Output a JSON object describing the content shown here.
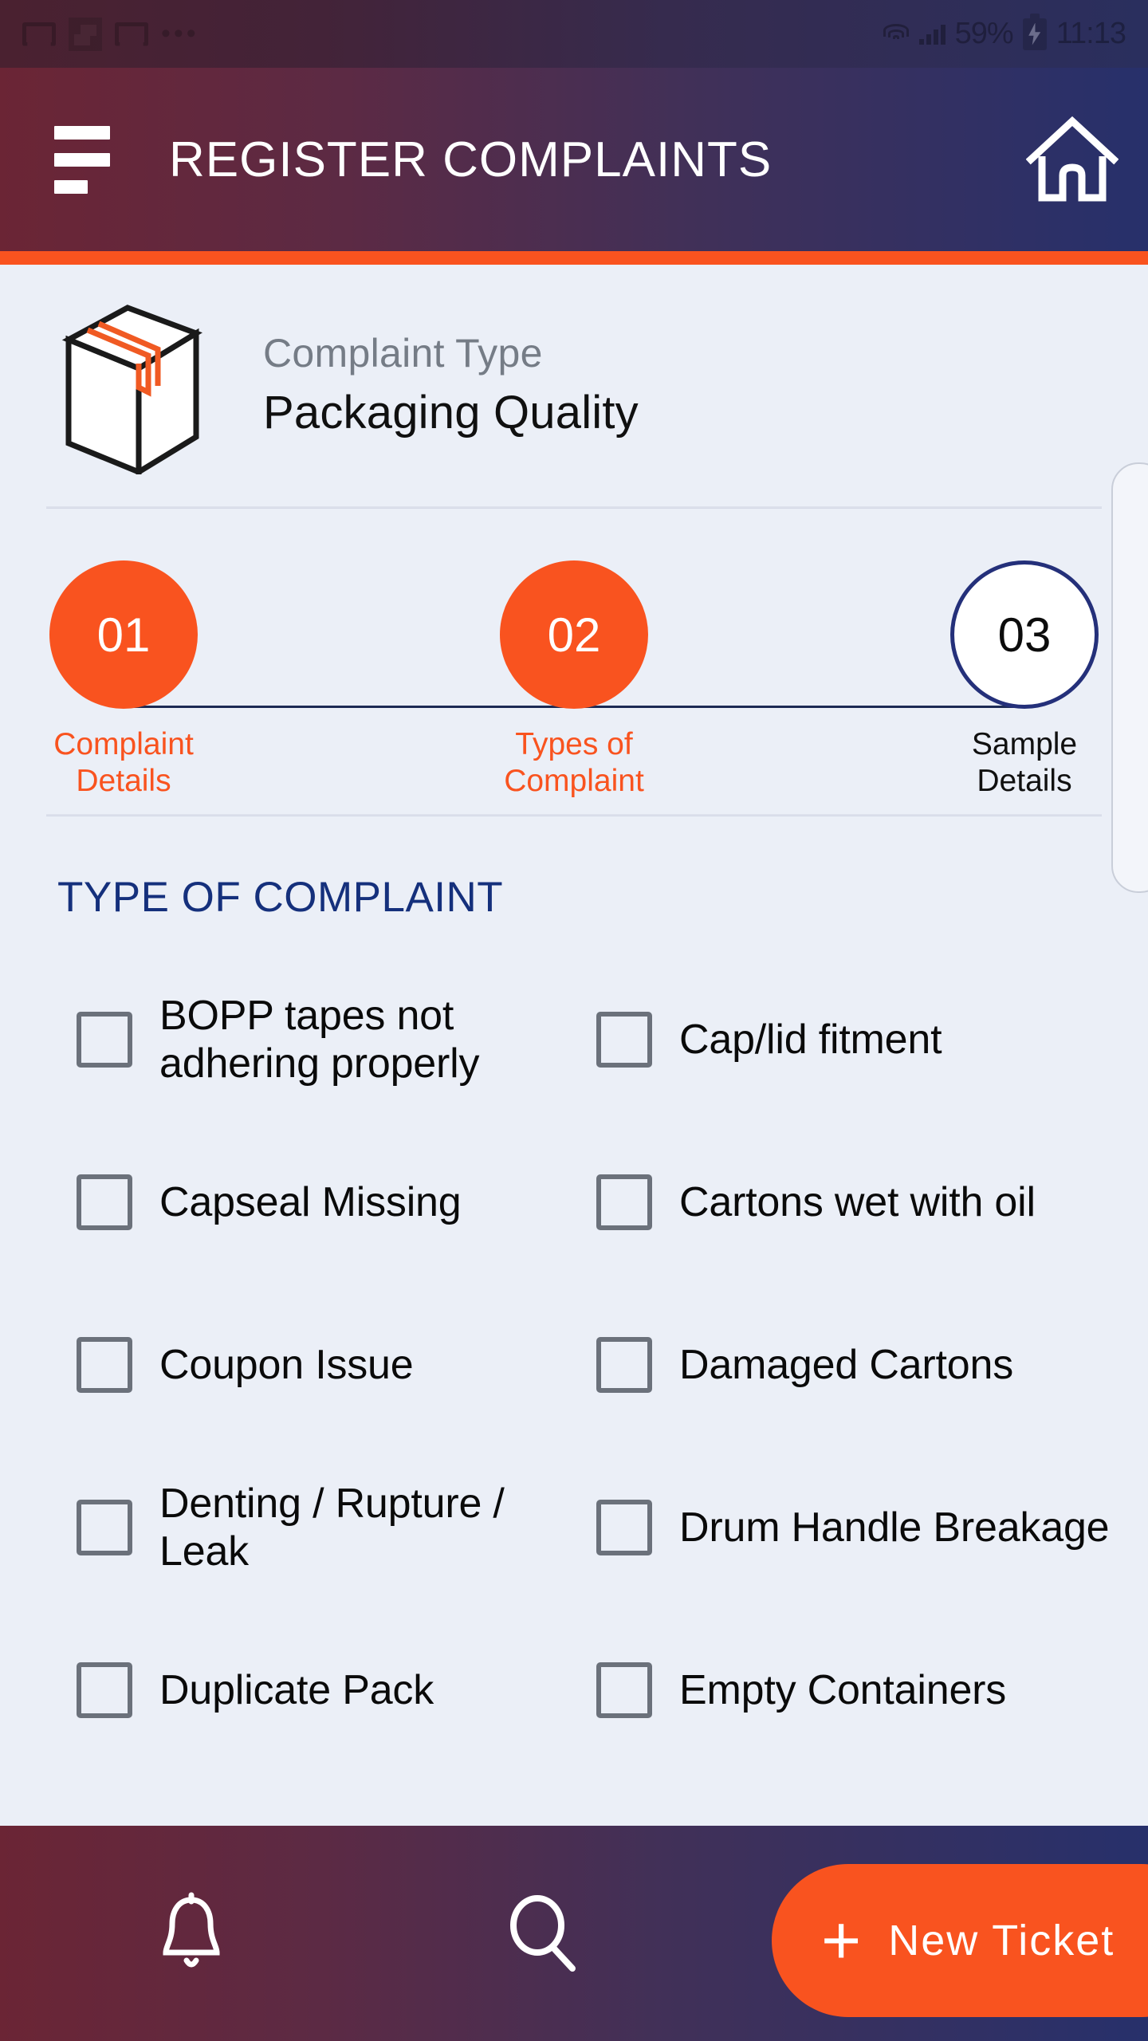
{
  "status_bar": {
    "notification_icons": [
      "gmail-icon",
      "file-manager-icon",
      "gmail-icon",
      "more-dots-icon"
    ],
    "wifi_icon": "wifi-icon",
    "signal_icon": "signal-bars-icon",
    "battery_percent": "59%",
    "battery_icon": "battery-charging-icon",
    "clock": "11:13"
  },
  "app_bar": {
    "menu_icon": "hamburger-menu-icon",
    "title": "REGISTER COMPLAINTS",
    "home_icon": "home-icon"
  },
  "colors": {
    "accent_orange": "#f9531f",
    "navy": "#15307c",
    "page_background": "#ebeff7",
    "checkbox_border": "#6b717b",
    "muted_text": "#757c86"
  },
  "complaint_type": {
    "icon": "package-box-icon",
    "label": "Complaint Type",
    "value": "Packaging Quality"
  },
  "stepper": {
    "steps": [
      {
        "number": "01",
        "label": "Complaint\nDetails",
        "label_line1": "Complaint",
        "label_line2": "Details",
        "state": "done"
      },
      {
        "number": "02",
        "label": "Types of\nComplaint",
        "label_line1": "Types of",
        "label_line2": "Complaint",
        "state": "done"
      },
      {
        "number": "03",
        "label": "Sample\nDetails",
        "label_line1": "Sample",
        "label_line2": "Details",
        "state": "pending"
      }
    ]
  },
  "complaint_section": {
    "title": "TYPE OF COMPLAINT",
    "options": [
      {
        "label": "BOPP tapes not adhering properly",
        "checked": false
      },
      {
        "label": "Cap/lid fitment",
        "checked": false
      },
      {
        "label": "Capseal Missing",
        "checked": false
      },
      {
        "label": "Cartons wet with oil",
        "checked": false
      },
      {
        "label": "Coupon Issue",
        "checked": false
      },
      {
        "label": "Damaged Cartons",
        "checked": false
      },
      {
        "label": "Denting / Rupture / Leak",
        "checked": false
      },
      {
        "label": "Drum Handle Breakage",
        "checked": false
      },
      {
        "label": "Duplicate Pack",
        "checked": false
      },
      {
        "label": "Empty Containers",
        "checked": false
      }
    ]
  },
  "bottom_bar": {
    "bell_icon": "bell-icon",
    "search_icon": "search-icon",
    "new_ticket_plus": "+",
    "new_ticket_label": "New Ticket"
  }
}
